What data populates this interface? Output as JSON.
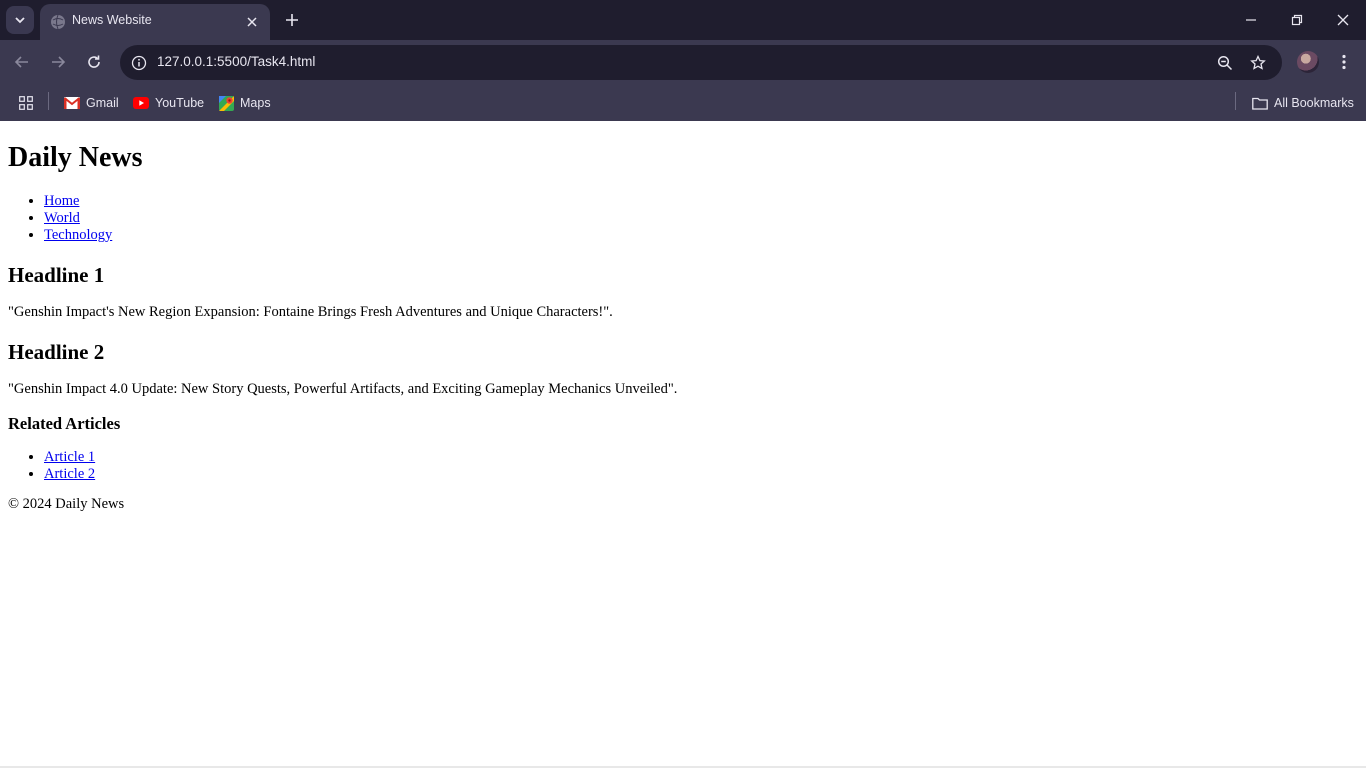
{
  "browser": {
    "tab_title": "News Website",
    "url": "127.0.0.1:5500/Task4.html",
    "bookmarks": [
      {
        "label": "Gmail",
        "icon": "gmail-icon"
      },
      {
        "label": "YouTube",
        "icon": "youtube-icon"
      },
      {
        "label": "Maps",
        "icon": "maps-icon"
      }
    ],
    "all_bookmarks_label": "All Bookmarks"
  },
  "page": {
    "title": "Daily News",
    "nav": [
      "Home",
      "World",
      "Technology"
    ],
    "articles": [
      {
        "headline": "Headline 1",
        "summary": "\"Genshin Impact's New Region Expansion: Fontaine Brings Fresh Adventures and Unique Characters!\"."
      },
      {
        "headline": "Headline 2",
        "summary": "\"Genshin Impact 4.0 Update: New Story Quests, Powerful Artifacts, and Exciting Gameplay Mechanics Unveiled\"."
      }
    ],
    "related_heading": "Related Articles",
    "related": [
      "Article 1",
      "Article 2"
    ],
    "footer": "© 2024 Daily News"
  },
  "colors": {
    "tabstrip_bg": "#1f1d2e",
    "toolbar_bg": "#3b3950",
    "link": "#0000ee"
  }
}
